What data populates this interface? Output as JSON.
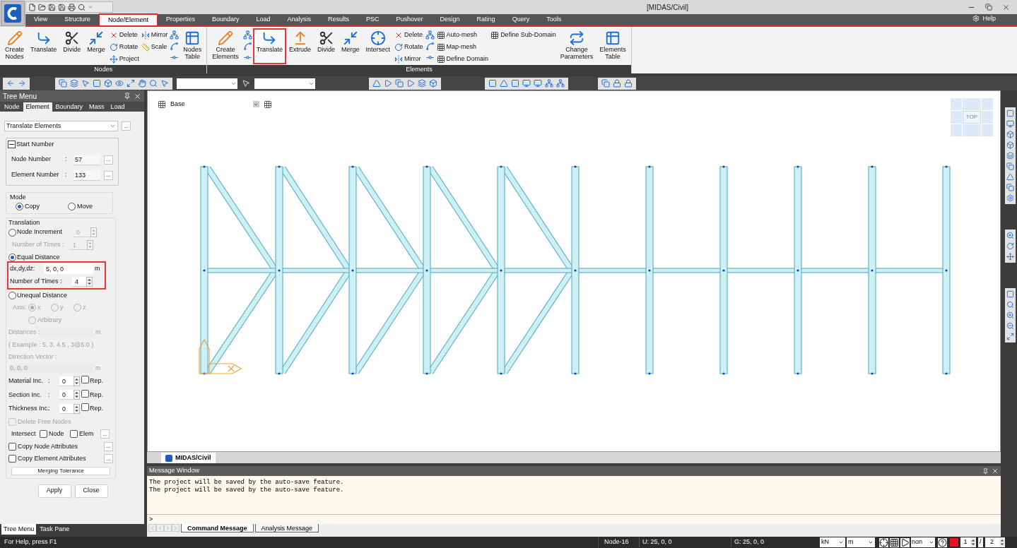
{
  "window": {
    "title": "[MIDAS/Civil]"
  },
  "menu_tabs": [
    {
      "label": "View",
      "selected": false
    },
    {
      "label": "Structure",
      "selected": false
    },
    {
      "label": "Node/Element",
      "selected": true
    },
    {
      "label": "Properties",
      "selected": false
    },
    {
      "label": "Boundary",
      "selected": false
    },
    {
      "label": "Load",
      "selected": false
    },
    {
      "label": "Analysis",
      "selected": false
    },
    {
      "label": "Results",
      "selected": false
    },
    {
      "label": "PSC",
      "selected": false
    },
    {
      "label": "Pushover",
      "selected": false
    },
    {
      "label": "Design",
      "selected": false
    },
    {
      "label": "Rating",
      "selected": false
    },
    {
      "label": "Query",
      "selected": false
    },
    {
      "label": "Tools",
      "selected": false
    }
  ],
  "help_menu": {
    "label": "Help"
  },
  "ribbon": {
    "groups": [
      {
        "label": "Nodes",
        "items": [
          {
            "kind": "large",
            "lines": [
              "Create",
              "Nodes"
            ],
            "highlighted": false
          },
          {
            "kind": "large",
            "lines": [
              "Translate"
            ],
            "highlighted": false
          },
          {
            "kind": "large",
            "lines": [
              "Divide"
            ],
            "highlighted": false
          },
          {
            "kind": "large",
            "lines": [
              "Merge"
            ],
            "highlighted": false
          },
          {
            "kind": "stack",
            "entries": [
              {
                "label": "Delete"
              },
              {
                "label": "Rotate"
              },
              {
                "label": "Project"
              }
            ]
          },
          {
            "kind": "stack",
            "entries": [
              {
                "label": "Mirror"
              },
              {
                "label": "Scale"
              }
            ]
          },
          {
            "kind": "icons"
          },
          {
            "kind": "large",
            "lines": [
              "Nodes",
              "Table"
            ],
            "highlighted": false
          }
        ]
      },
      {
        "label": "Elements",
        "items": [
          {
            "kind": "large",
            "lines": [
              "Create",
              "Elements"
            ],
            "highlighted": false
          },
          {
            "kind": "icons"
          },
          {
            "kind": "large",
            "lines": [
              "Translate"
            ],
            "highlighted": true
          },
          {
            "kind": "large",
            "lines": [
              "Extrude"
            ],
            "highlighted": false
          },
          {
            "kind": "large",
            "lines": [
              "Divide"
            ],
            "highlighted": false
          },
          {
            "kind": "large",
            "lines": [
              "Merge"
            ],
            "highlighted": false
          },
          {
            "kind": "large",
            "lines": [
              "Intersect"
            ],
            "highlighted": false
          },
          {
            "kind": "stack",
            "entries": [
              {
                "label": "Delete"
              },
              {
                "label": "Rotate"
              },
              {
                "label": "Mirror"
              }
            ]
          },
          {
            "kind": "icons"
          },
          {
            "kind": "stack",
            "entries": [
              {
                "label": "Auto-mesh"
              },
              {
                "label": "Map-mesh"
              },
              {
                "label": "Define Domain"
              }
            ]
          },
          {
            "kind": "stack",
            "entries": [
              {
                "label": "Define Sub-Domain"
              }
            ]
          },
          {
            "kind": "large",
            "lines": [
              "Change",
              "Parameters"
            ],
            "highlighted": false
          },
          {
            "kind": "large",
            "lines": [
              "Elements",
              "Table"
            ],
            "highlighted": false
          }
        ]
      }
    ]
  },
  "tree_menu": {
    "title": "Tree Menu",
    "tabs": [
      {
        "label": "Node",
        "selected": false
      },
      {
        "label": "Element",
        "selected": true
      },
      {
        "label": "Boundary",
        "selected": false
      },
      {
        "label": "Mass",
        "selected": false
      },
      {
        "label": "Load",
        "selected": false
      }
    ],
    "function_select": {
      "value": "Translate Elements",
      "more": "..."
    },
    "start_number": {
      "title": "Start Number",
      "expanded": true,
      "fields": [
        {
          "label": "Node Number",
          "colon": ":",
          "value": "57",
          "more": "..."
        },
        {
          "label": "Element Number",
          "colon": ":",
          "value": "133",
          "more": "..."
        }
      ]
    },
    "mode": {
      "title": "Mode",
      "options": [
        {
          "label": "Copy",
          "selected": true
        },
        {
          "label": "Move",
          "selected": false
        }
      ]
    },
    "translation": {
      "title": "Translation",
      "node_increment": {
        "label": "Node Increment",
        "selected": false,
        "value": "0",
        "times_label": "Number of Times :",
        "times_value": "1"
      },
      "equal_distance": {
        "label": "Equal Distance",
        "selected": true,
        "highlighted": true,
        "delta_label": "dx,dy,dz:",
        "delta_value": "5, 0, 0",
        "unit": "m",
        "times_label": "Number of Times :",
        "times_value": "4"
      },
      "unequal_distance": {
        "label": "Unequal Distance",
        "selected": false,
        "axis_label": "Axis:",
        "axes": [
          {
            "label": "x",
            "selected": true
          },
          {
            "label": "y",
            "selected": false
          },
          {
            "label": "z",
            "selected": false
          },
          {
            "label": "Arbitrary",
            "selected": false
          }
        ],
        "distances_label": "Distances :",
        "distances_unit": "m",
        "example": "( Example :  5, 3, 4.5 , 3@5.0 )",
        "direction_label": "Direction Vector :",
        "direction_value": "0, 0, 0",
        "direction_unit": "m"
      },
      "increments": [
        {
          "label": "Material Inc.",
          "colon": ":",
          "value": "0",
          "rep_label": "Rep.",
          "rep_checked": false
        },
        {
          "label": "Section Inc.",
          "colon": ":",
          "value": "0",
          "rep_label": "Rep.",
          "rep_checked": false
        },
        {
          "label": "Thickness Inc.",
          "colon": ":",
          "value": "0",
          "rep_label": "Rep.",
          "rep_checked": false
        }
      ],
      "delete_free_nodes": {
        "label": "Delete Free Nodes",
        "checked": false,
        "disabled": true
      },
      "intersect": {
        "label": "Intersect",
        "options": [
          {
            "label": "Node",
            "checked": false
          },
          {
            "label": "Elem",
            "checked": false
          }
        ],
        "more": "..."
      },
      "copy_options": [
        {
          "label": "Copy Node Attributes",
          "checked": false,
          "more": "..."
        },
        {
          "label": "Copy Element Attributes",
          "checked": false,
          "more": "..."
        }
      ],
      "merging_tolerance": "Merging Tolerance"
    },
    "buttons": [
      "Apply",
      "Close"
    ],
    "bottom_tabs": [
      {
        "label": "Tree Menu",
        "selected": true
      },
      {
        "label": "Task Pane",
        "selected": false
      }
    ]
  },
  "view": {
    "layer_label": "Base",
    "view_cube_face": "TOP",
    "tab": "MIDAS/Civil"
  },
  "message_window": {
    "title": "Message Window",
    "lines": [
      "The project will be saved by the auto-save feature.",
      "The project will be saved by the auto-save feature."
    ],
    "prompt": ">",
    "tabs": [
      {
        "label": "Command Message",
        "selected": true
      },
      {
        "label": "Analysis Message",
        "selected": false
      }
    ]
  },
  "status_bar": {
    "help": "For Help, press F1",
    "node": "Node-16",
    "local": "U: 25, 0, 0",
    "global": "G: 25, 0, 0",
    "force_unit": "kN",
    "length_unit": "m",
    "filter": "non",
    "page": "1",
    "separator": "/",
    "page_count": "2"
  }
}
